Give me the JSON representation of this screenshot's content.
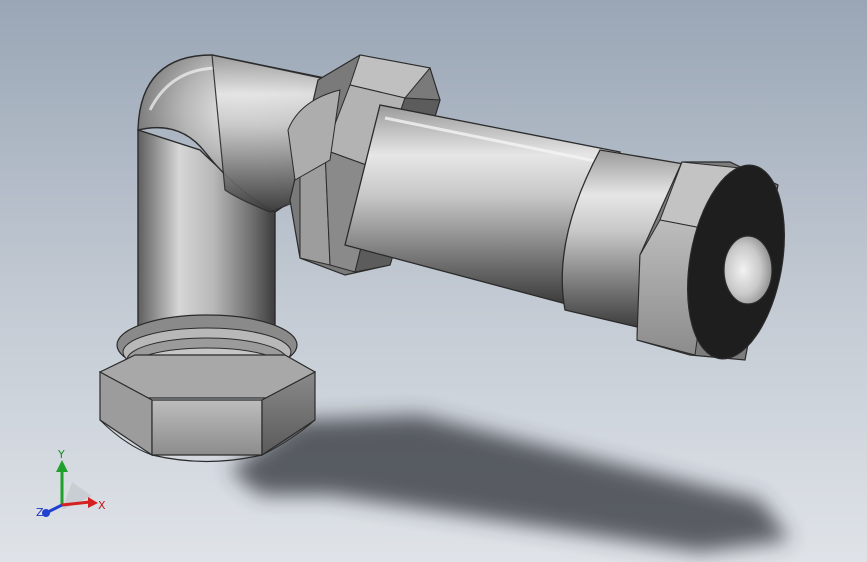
{
  "viewport": {
    "background_top": "#9aa6b6",
    "background_bottom": "#dfe3e8",
    "model": "elbow-fitting-with-hex-nuts"
  },
  "triad": {
    "x_label": "X",
    "y_label": "Y",
    "z_label": "Z",
    "x_color": "#d42020",
    "y_color": "#1fa02a",
    "z_color": "#2040d0"
  }
}
